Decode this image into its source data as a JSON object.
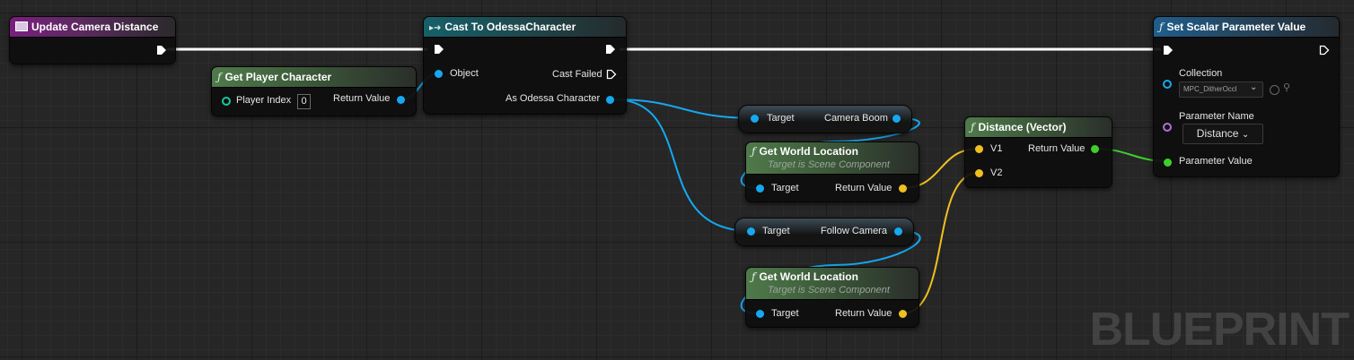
{
  "graph": {
    "watermark": "BLUEPRINT"
  },
  "nodes": {
    "update_camera_distance": {
      "title": "Update Camera Distance"
    },
    "get_player_character": {
      "title": "Get Player Character",
      "player_index_label": "Player Index",
      "player_index_value": "0",
      "return_value_label": "Return Value"
    },
    "cast_to_odessa": {
      "title": "Cast To OdessaCharacter",
      "object_label": "Object",
      "cast_failed_label": "Cast Failed",
      "as_label": "As Odessa Character"
    },
    "camera_boom": {
      "target_label": "Target",
      "output_label": "Camera Boom"
    },
    "follow_camera": {
      "target_label": "Target",
      "output_label": "Follow Camera"
    },
    "get_world_location_1": {
      "title": "Get World Location",
      "subtitle": "Target is Scene Component",
      "target_label": "Target",
      "return_value_label": "Return Value"
    },
    "get_world_location_2": {
      "title": "Get World Location",
      "subtitle": "Target is Scene Component",
      "target_label": "Target",
      "return_value_label": "Return Value"
    },
    "distance_vector": {
      "title": "Distance (Vector)",
      "v1_label": "V1",
      "v2_label": "V2",
      "return_value_label": "Return Value"
    },
    "set_scalar_param": {
      "title": "Set Scalar Parameter Value",
      "collection_label": "Collection",
      "collection_value": "MPC_DitherOccl",
      "parameter_name_label": "Parameter Name",
      "parameter_name_value": "Distance",
      "parameter_value_label": "Parameter Value"
    }
  },
  "colors": {
    "exec_wire": "#ffffff",
    "object_wire": "#16a8f0",
    "vector_wire": "#f0c020",
    "float_wire": "#3ecf2c",
    "event_header": "#7a1f7e",
    "function_header": "#4f7a4a",
    "cast_header": "#16606a"
  },
  "icons": {
    "event": "event-icon",
    "function": "function-icon",
    "cast": "cast-icon",
    "exec_pin": "exec-pin-icon",
    "browse": "browse-icon",
    "search": "search-icon",
    "chevron": "chevron-down-icon"
  }
}
